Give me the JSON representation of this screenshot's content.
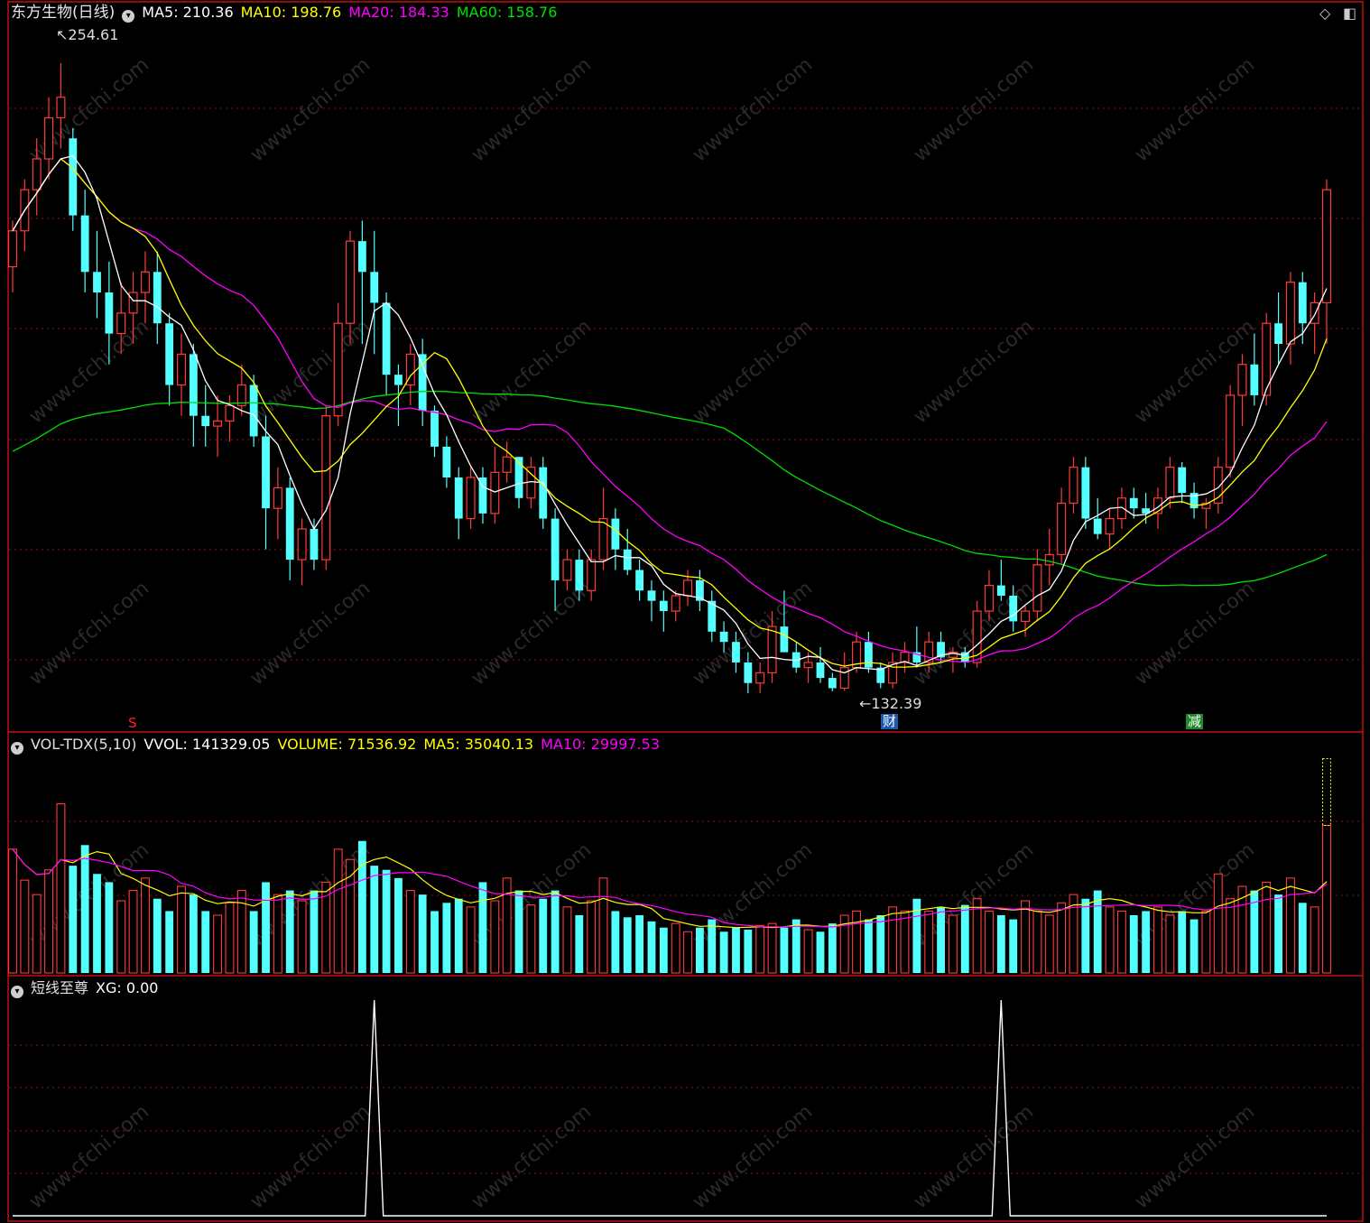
{
  "colors": {
    "up": "#ff3a3a",
    "down": "#54ffff",
    "ma5": "#ffffff",
    "ma10": "#ffff00",
    "ma20": "#ff00ff",
    "ma60": "#00e000",
    "grid": "#8b1010",
    "border": "#c01010"
  },
  "price_panel": {
    "title": "东方生物(日线)",
    "ma5_label": "MA5: 210.36",
    "ma10_label": "MA10: 198.76",
    "ma20_label": "MA20: 184.33",
    "ma60_label": "MA60: 158.76",
    "high_label": "254.61",
    "low_label": "132.39",
    "badge_s": "S",
    "badge_cai": "财",
    "badge_jian": "减"
  },
  "vol_panel": {
    "name": "VOL-TDX(5,10)",
    "vvol_label": "VVOL: 141329.05",
    "volume_label": "VOLUME: 71536.92",
    "ma5_label": "MA5: 35040.13",
    "ma10_label": "MA10: 29997.53"
  },
  "ind_panel": {
    "name": "短线至尊",
    "xg_label": "XG: 0.00"
  },
  "watermark": "www.cfchi.com",
  "chart_data": [
    {
      "type": "candlestick",
      "title": "东方生物(日线)",
      "price_range": [
        132.39,
        254.61
      ],
      "high": 254.61,
      "low": 132.39,
      "last_ma": {
        "MA5": 210.36,
        "MA10": 198.76,
        "MA20": 184.33,
        "MA60": 158.76
      },
      "ohlc": [
        [
          215,
          224,
          210,
          222
        ],
        [
          222,
          232,
          218,
          230
        ],
        [
          230,
          240,
          225,
          236
        ],
        [
          236,
          248,
          232,
          244
        ],
        [
          244,
          254.61,
          238,
          248
        ],
        [
          240,
          242,
          222,
          225
        ],
        [
          225,
          230,
          210,
          214
        ],
        [
          214,
          222,
          205,
          210
        ],
        [
          210,
          216,
          196,
          202
        ],
        [
          202,
          212,
          198,
          206
        ],
        [
          206,
          214,
          200,
          210
        ],
        [
          210,
          218,
          204,
          214
        ],
        [
          214,
          218,
          200,
          204
        ],
        [
          204,
          206,
          188,
          192
        ],
        [
          192,
          202,
          186,
          198
        ],
        [
          198,
          200,
          180,
          186
        ],
        [
          186,
          192,
          180,
          184
        ],
        [
          184,
          190,
          178,
          185
        ],
        [
          185,
          190,
          181,
          188
        ],
        [
          188,
          196,
          186,
          192
        ],
        [
          192,
          194,
          180,
          182
        ],
        [
          182,
          186,
          160,
          168
        ],
        [
          168,
          176,
          162,
          172
        ],
        [
          172,
          174,
          154,
          158
        ],
        [
          158,
          166,
          153,
          164
        ],
        [
          164,
          166,
          156,
          158
        ],
        [
          158,
          188,
          156,
          186
        ],
        [
          186,
          208,
          184,
          204
        ],
        [
          204,
          222,
          200,
          220
        ],
        [
          220,
          224,
          200,
          214
        ],
        [
          214,
          222,
          198,
          208
        ],
        [
          208,
          210,
          190,
          194
        ],
        [
          194,
          196,
          184,
          192
        ],
        [
          192,
          200,
          188,
          198
        ],
        [
          198,
          201,
          184,
          187
        ],
        [
          187,
          188,
          178,
          180
        ],
        [
          180,
          182,
          172,
          174
        ],
        [
          174,
          176,
          162,
          166
        ],
        [
          166,
          176,
          164,
          174
        ],
        [
          174,
          176,
          165,
          167
        ],
        [
          167,
          180,
          165,
          175
        ],
        [
          175,
          181,
          173,
          178
        ],
        [
          178,
          178,
          168,
          170
        ],
        [
          170,
          178,
          168,
          176
        ],
        [
          176,
          178,
          164,
          166
        ],
        [
          166,
          168,
          148,
          154
        ],
        [
          154,
          160,
          152,
          158
        ],
        [
          158,
          160,
          150,
          152
        ],
        [
          152,
          160,
          150,
          158
        ],
        [
          158,
          172,
          156,
          166
        ],
        [
          166,
          168,
          156,
          160
        ],
        [
          160,
          164,
          155,
          156
        ],
        [
          156,
          158,
          150,
          152
        ],
        [
          152,
          154,
          146,
          150
        ],
        [
          150,
          152,
          144,
          148
        ],
        [
          148,
          152,
          146,
          151
        ],
        [
          151,
          156,
          149,
          154
        ],
        [
          154,
          156,
          148,
          150
        ],
        [
          150,
          152,
          142,
          144
        ],
        [
          144,
          146,
          140,
          142
        ],
        [
          142,
          144,
          136,
          138
        ],
        [
          138,
          140,
          132,
          134
        ],
        [
          134,
          138,
          132,
          136
        ],
        [
          136,
          148,
          134,
          145
        ],
        [
          145,
          152,
          142,
          140
        ],
        [
          140,
          142,
          136,
          137
        ],
        [
          137,
          140,
          134,
          138
        ],
        [
          138,
          141,
          134,
          135
        ],
        [
          135,
          136,
          132.39,
          133
        ],
        [
          133,
          140,
          132.5,
          137
        ],
        [
          137,
          144,
          136,
          142
        ],
        [
          142,
          144,
          136,
          137
        ],
        [
          137,
          138,
          133,
          134
        ],
        [
          134,
          140,
          133,
          138
        ],
        [
          138,
          142,
          136,
          140
        ],
        [
          140,
          145,
          137,
          138
        ],
        [
          138,
          144,
          136,
          142
        ],
        [
          142,
          144,
          138,
          139
        ],
        [
          139,
          141,
          136,
          140
        ],
        [
          140,
          141,
          137,
          138
        ],
        [
          138,
          150,
          137,
          148
        ],
        [
          148,
          156,
          146,
          153
        ],
        [
          153,
          158,
          150,
          151
        ],
        [
          151,
          153,
          144,
          146
        ],
        [
          146,
          149,
          143,
          148
        ],
        [
          148,
          160,
          146,
          157
        ],
        [
          157,
          164,
          153,
          159
        ],
        [
          159,
          172,
          157,
          169
        ],
        [
          169,
          178,
          167,
          176
        ],
        [
          176,
          178,
          164,
          166
        ],
        [
          166,
          170,
          162,
          163
        ],
        [
          163,
          168,
          160,
          166
        ],
        [
          166,
          172,
          164,
          170
        ],
        [
          170,
          172,
          166,
          168
        ],
        [
          168,
          171,
          165,
          167
        ],
        [
          167,
          172,
          164,
          170
        ],
        [
          170,
          178,
          168,
          176
        ],
        [
          176,
          177,
          169,
          171
        ],
        [
          171,
          173,
          166,
          168
        ],
        [
          168,
          170,
          164,
          169
        ],
        [
          169,
          178,
          167,
          176
        ],
        [
          176,
          192,
          174,
          190
        ],
        [
          190,
          198,
          184,
          196
        ],
        [
          196,
          202,
          188,
          190
        ],
        [
          190,
          206,
          188,
          204
        ],
        [
          204,
          210,
          196,
          200
        ],
        [
          200,
          214,
          196,
          212
        ],
        [
          212,
          214,
          200,
          204
        ],
        [
          204,
          210,
          198,
          208
        ],
        [
          208,
          232,
          200,
          230
        ]
      ],
      "volume": [
        60000,
        45000,
        38000,
        50000,
        82000,
        52000,
        62000,
        48000,
        44000,
        35000,
        40000,
        46000,
        36000,
        30000,
        42000,
        38000,
        30000,
        28000,
        34000,
        40000,
        30000,
        44000,
        38000,
        40000,
        35000,
        40000,
        44000,
        60000,
        55000,
        64000,
        52000,
        50000,
        46000,
        40000,
        38000,
        30000,
        34000,
        36000,
        32000,
        44000,
        35000,
        46000,
        40000,
        33000,
        36000,
        40000,
        32000,
        28000,
        35000,
        46000,
        30000,
        27000,
        28000,
        25000,
        22000,
        24000,
        20000,
        22000,
        26000,
        20000,
        22000,
        21000,
        23000,
        24000,
        22000,
        26000,
        21000,
        20000,
        24000,
        28000,
        30000,
        26000,
        28000,
        32000,
        30000,
        36000,
        30000,
        32000,
        28000,
        33000,
        36000,
        30000,
        28000,
        26000,
        35000,
        30000,
        28000,
        34000,
        38000,
        36000,
        40000,
        32000,
        30000,
        28000,
        30000,
        32000,
        28000,
        30000,
        26000,
        30000,
        48000,
        36000,
        42000,
        40000,
        44000,
        38000,
        46000,
        34000,
        32000,
        71536.92
      ],
      "vol_ma5_last": 35040.13,
      "vol_ma10_last": 29997.53,
      "vvol": 141329.05
    },
    {
      "type": "line",
      "series": [
        {
          "name": "XG",
          "last": 0.0,
          "signals_at_candle_index": [
            30,
            82
          ]
        }
      ],
      "ylim": [
        0,
        1
      ]
    }
  ]
}
